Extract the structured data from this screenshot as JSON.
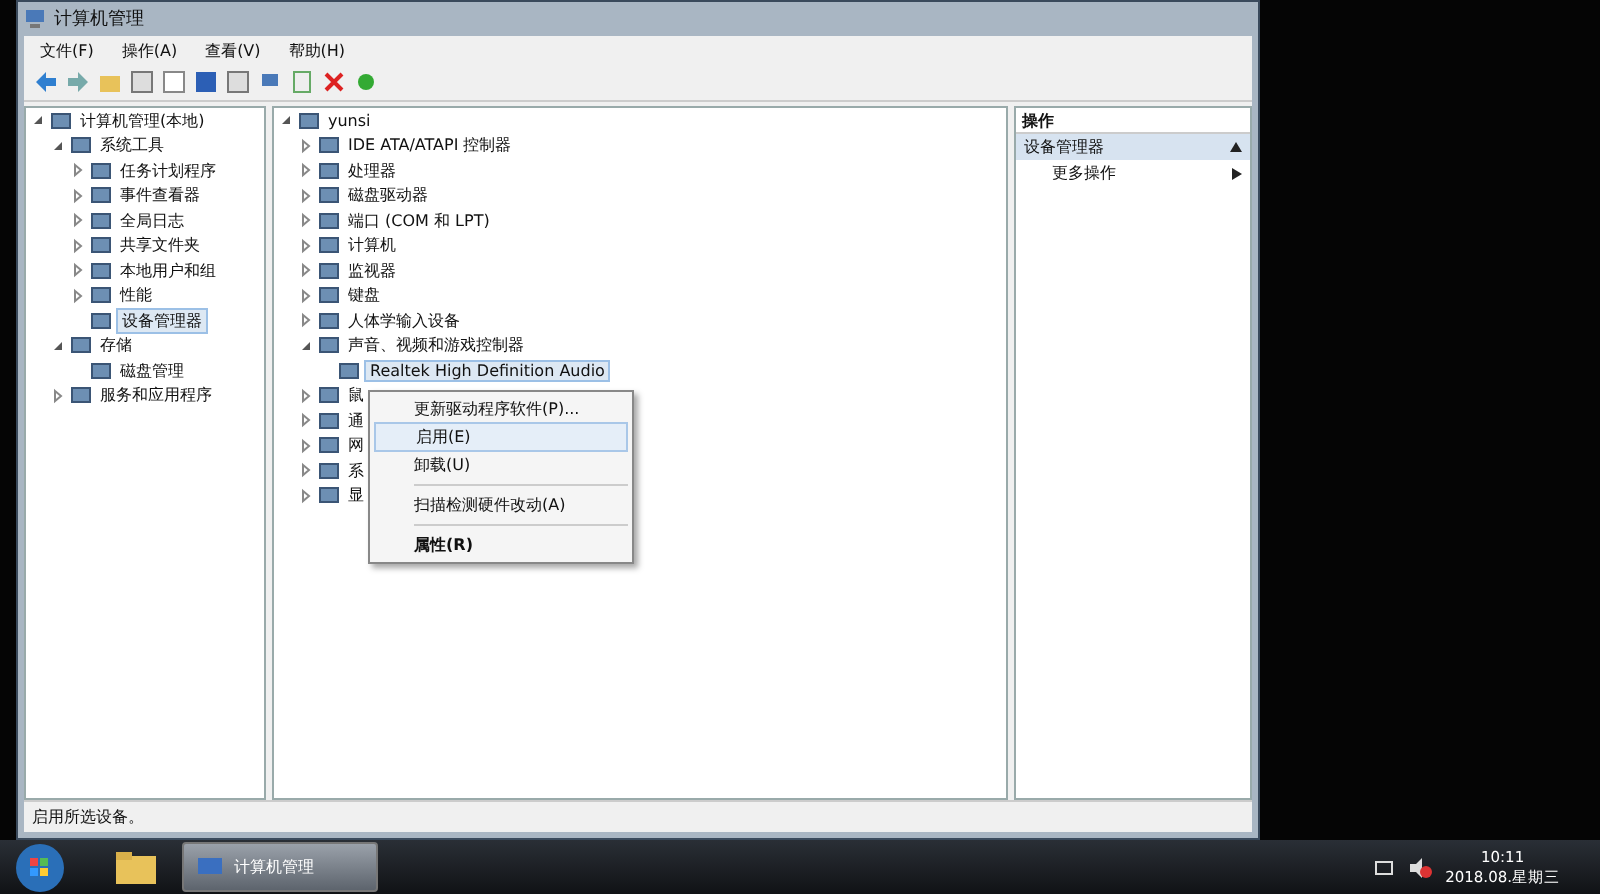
{
  "window": {
    "title": "计算机管理"
  },
  "menu": [
    "文件(F)",
    "操作(A)",
    "查看(V)",
    "帮助(H)"
  ],
  "left_tree": [
    {
      "label": "计算机管理(本地)",
      "expanded": true,
      "selected": false,
      "children": [
        {
          "label": "系统工具",
          "expanded": true,
          "selected": false,
          "children": [
            {
              "label": "任务计划程序",
              "expanded": false,
              "selected": false
            },
            {
              "label": "事件查看器",
              "expanded": false,
              "selected": false
            },
            {
              "label": "全局日志",
              "expanded": false,
              "selected": false
            },
            {
              "label": "共享文件夹",
              "expanded": false,
              "selected": false
            },
            {
              "label": "本地用户和组",
              "expanded": false,
              "selected": false
            },
            {
              "label": "性能",
              "expanded": false,
              "selected": false
            },
            {
              "label": "设备管理器",
              "selected": true
            }
          ]
        },
        {
          "label": "存储",
          "expanded": true,
          "selected": false,
          "children": [
            {
              "label": "磁盘管理",
              "selected": false
            }
          ]
        },
        {
          "label": "服务和应用程序",
          "expanded": false,
          "selected": false
        }
      ]
    }
  ],
  "device_tree": [
    {
      "label": "yunsi",
      "expanded": true,
      "selected": false,
      "children": [
        {
          "label": "IDE ATA/ATAPI 控制器",
          "expanded": false,
          "selected": false
        },
        {
          "label": "处理器",
          "expanded": false,
          "selected": false
        },
        {
          "label": "磁盘驱动器",
          "expanded": false,
          "selected": false
        },
        {
          "label": "端口 (COM 和 LPT)",
          "expanded": false,
          "selected": false
        },
        {
          "label": "计算机",
          "expanded": false,
          "selected": false
        },
        {
          "label": "监视器",
          "expanded": false,
          "selected": false
        },
        {
          "label": "键盘",
          "expanded": false,
          "selected": false
        },
        {
          "label": "人体学输入设备",
          "expanded": false,
          "selected": false
        },
        {
          "label": "声音、视频和游戏控制器",
          "expanded": true,
          "selected": false,
          "children": [
            {
              "label": "Realtek High Definition Audio",
              "selected": true
            }
          ]
        },
        {
          "label": "鼠",
          "expanded": false,
          "selected": false
        },
        {
          "label": "通",
          "expanded": false,
          "selected": false
        },
        {
          "label": "网",
          "expanded": false,
          "selected": false
        },
        {
          "label": "系",
          "expanded": false,
          "selected": false
        },
        {
          "label": "显",
          "expanded": false,
          "selected": false
        }
      ]
    }
  ],
  "context_menu": [
    {
      "label": "更新驱动程序软件(P)...",
      "selected": false,
      "bold": false
    },
    {
      "label": "启用(E)",
      "selected": true,
      "bold": false
    },
    {
      "label": "卸载(U)",
      "selected": false,
      "bold": false
    },
    {
      "label": "扫描检测硬件改动(A)",
      "selected": false,
      "bold": false
    },
    {
      "label": "属性(R)",
      "selected": false,
      "bold": true
    }
  ],
  "actions": {
    "header": "操作",
    "section": "设备管理器",
    "items": [
      "更多操作"
    ]
  },
  "status_bar": "启用所选设备。",
  "taskbar": {
    "window_button": "计算机管理",
    "time": "10:11",
    "date": "2018.08.星期三"
  }
}
